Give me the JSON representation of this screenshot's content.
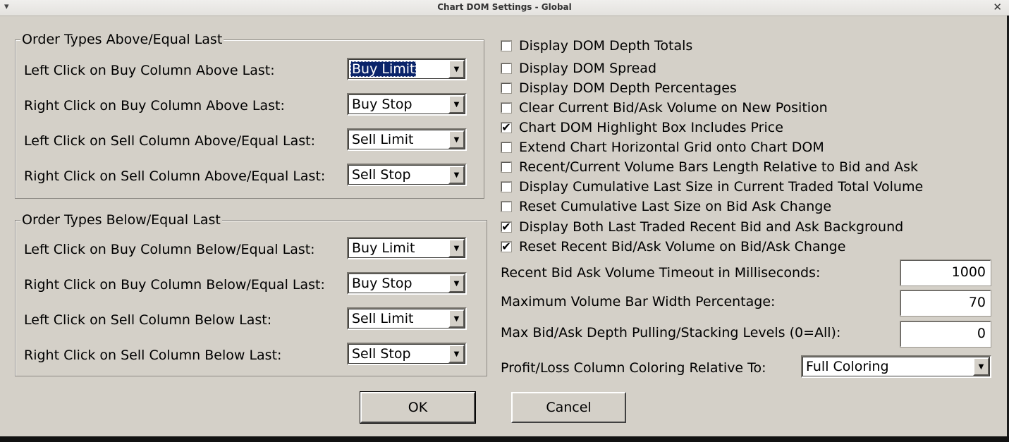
{
  "window": {
    "title": "Chart DOM Settings - Global"
  },
  "group_above": {
    "title": "Order Types Above/Equal Last",
    "rows": [
      {
        "label": "Left Click on Buy Column Above Last:",
        "value": "Buy Limit"
      },
      {
        "label": "Right Click on Buy Column Above Last:",
        "value": "Buy Stop"
      },
      {
        "label": "Left Click on Sell Column Above/Equal Last:",
        "value": "Sell Limit"
      },
      {
        "label": "Right Click on Sell Column Above/Equal Last:",
        "value": "Sell Stop"
      }
    ]
  },
  "group_below": {
    "title": "Order Types Below/Equal Last",
    "rows": [
      {
        "label": "Left Click on Buy Column Below/Equal Last:",
        "value": "Buy Limit"
      },
      {
        "label": "Right Click on Buy Column Below/Equal Last:",
        "value": "Buy Stop"
      },
      {
        "label": "Left Click on Sell Column Below Last:",
        "value": "Sell Limit"
      },
      {
        "label": "Right Click on Sell Column Below Last:",
        "value": "Sell Stop"
      }
    ]
  },
  "checkboxes": [
    {
      "label": "Display DOM Depth Totals",
      "checked": false
    },
    {
      "label": "Display DOM Spread",
      "checked": false
    },
    {
      "label": "Display DOM Depth Percentages",
      "checked": false
    },
    {
      "label": "Clear Current Bid/Ask Volume on New Position",
      "checked": false
    },
    {
      "label": "Chart DOM Highlight Box Includes Price",
      "checked": true
    },
    {
      "label": "Extend Chart Horizontal Grid onto Chart DOM",
      "checked": false
    },
    {
      "label": "Recent/Current Volume Bars Length Relative to Bid and Ask",
      "checked": false
    },
    {
      "label": "Display Cumulative Last Size in Current Traded Total Volume",
      "checked": false
    },
    {
      "label": "Reset Cumulative Last Size on Bid Ask Change",
      "checked": false
    },
    {
      "label": "Display Both Last Traded Recent Bid and Ask Background",
      "checked": true
    },
    {
      "label": "Reset Recent Bid/Ask Volume on Bid/Ask Change",
      "checked": true
    }
  ],
  "fields": [
    {
      "label": "Recent Bid Ask Volume Timeout in Milliseconds:",
      "value": "1000"
    },
    {
      "label": "Maximum Volume Bar Width Percentage:",
      "value": "70"
    },
    {
      "label": "Max Bid/Ask Depth Pulling/Stacking Levels (0=All):",
      "value": "0"
    }
  ],
  "pl_coloring": {
    "label": "Profit/Loss Column Coloring Relative To:",
    "value": "Full Coloring"
  },
  "buttons": {
    "ok": "OK",
    "cancel": "Cancel"
  },
  "check_mark": "✔"
}
